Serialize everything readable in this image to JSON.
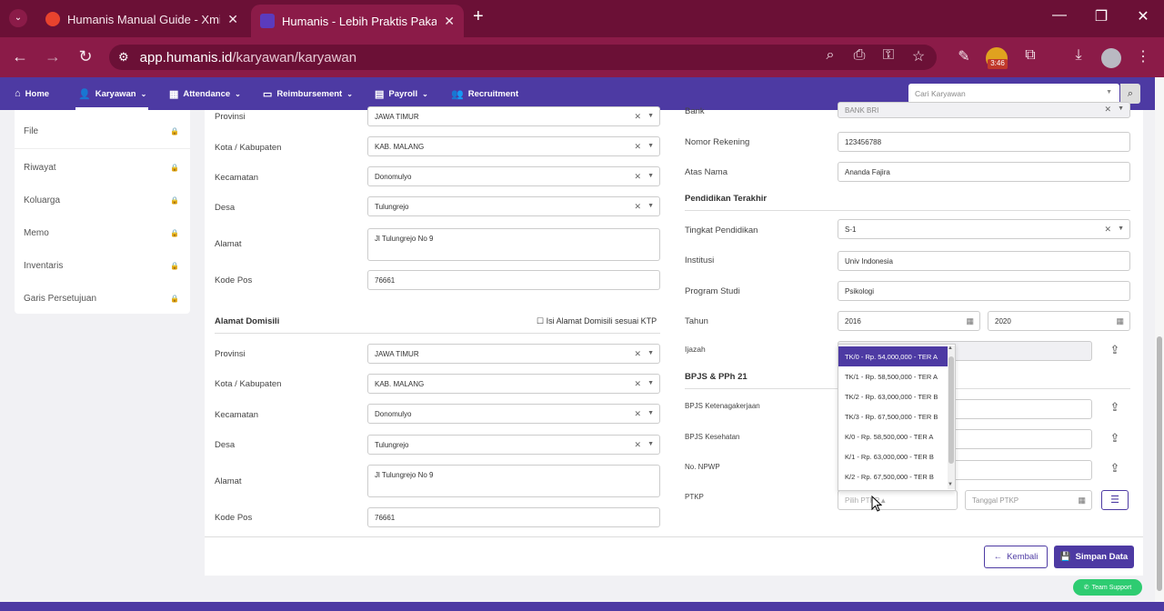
{
  "browser": {
    "tabs": [
      {
        "label": "Humanis Manual Guide - Xmind"
      },
      {
        "label": "Humanis - Lebih Praktis Pakai H"
      }
    ],
    "new_tab": "+",
    "url_domain": "app.humanis.id",
    "url_path": "/karyawan/karyawan",
    "badge": "3:46"
  },
  "nav": {
    "items": [
      {
        "label": "Home"
      },
      {
        "label": "Karyawan"
      },
      {
        "label": "Attendance"
      },
      {
        "label": "Reimbursement"
      },
      {
        "label": "Payroll"
      },
      {
        "label": "Recruitment"
      }
    ],
    "search_placeholder": "Cari Karyawan"
  },
  "sidebar": {
    "items": [
      {
        "label": "File"
      },
      {
        "label": "Riwayat"
      },
      {
        "label": "Koluarga"
      },
      {
        "label": "Memo"
      },
      {
        "label": "Inventaris"
      },
      {
        "label": "Garis Persetujuan"
      }
    ]
  },
  "ktp": {
    "provinsi_label": "Provinsi",
    "provinsi": "JAWA TIMUR",
    "kota_label": "Kota / Kabupaten",
    "kota": "KAB. MALANG",
    "kecamatan_label": "Kecamatan",
    "kecamatan": "Donomulyo",
    "desa_label": "Desa",
    "desa": "Tulungrejo",
    "alamat_label": "Alamat",
    "alamat": "Jl Tulungrejo No 9",
    "kodepos_label": "Kode Pos",
    "kodepos": "76661"
  },
  "domisili": {
    "title": "Alamat Domisili",
    "checkbox_label": "Isi Alamat Domisili sesuai KTP",
    "provinsi_label": "Provinsi",
    "provinsi": "JAWA TIMUR",
    "kota_label": "Kota / Kabupaten",
    "kota": "KAB. MALANG",
    "kecamatan_label": "Kecamatan",
    "kecamatan": "Donomulyo",
    "desa_label": "Desa",
    "desa": "Tulungrejo",
    "alamat_label": "Alamat",
    "alamat": "Jl Tulungrejo No 9",
    "kodepos_label": "Kode Pos",
    "kodepos": "76661"
  },
  "bank": {
    "bank_label": "Bank",
    "bank": "BANK BRI",
    "rekening_label": "Nomor Rekening",
    "rekening": "123456788",
    "atasnama_label": "Atas Nama",
    "atasnama": "Ananda Fajira"
  },
  "pendidikan": {
    "title": "Pendidikan Terakhir",
    "tingkat_label": "Tingkat Pendidikan",
    "tingkat": "S-1",
    "institusi_label": "Institusi",
    "institusi": "Univ Indonesia",
    "prodi_label": "Program Studi",
    "prodi": "Psikologi",
    "tahun_label": "Tahun",
    "tahun_start": "2016",
    "tahun_end": "2020",
    "ijazah_label": "Ijazah"
  },
  "bpjs": {
    "title": "BPJS & PPh 21",
    "ketenagakerjaan_label": "BPJS Ketenagakerjaan",
    "kesehatan_label": "BPJS Kesehatan",
    "npwp_label": "No. NPWP",
    "ptkp_label": "PTKP",
    "ptkp_placeholder": "Pilih PTKP",
    "tanggal_placeholder": "Tanggal PTKP",
    "options": [
      "TK/0 - Rp. 54,000,000 - TER A",
      "TK/1 - Rp. 58,500,000 - TER A",
      "TK/2 - Rp. 63,000,000 - TER B",
      "TK/3 - Rp. 67,500,000 - TER B",
      "K/0 - Rp. 58,500,000 - TER A",
      "K/1 - Rp. 63,000,000 - TER B",
      "K/2 - Rp. 67,500,000 - TER B"
    ]
  },
  "actions": {
    "back": "Kembali",
    "save": "Simpan Data",
    "support": "Team Support"
  },
  "colors": {
    "brand": "#4d3aa3",
    "browser": "#8b1b48",
    "support": "#2ecc71"
  }
}
